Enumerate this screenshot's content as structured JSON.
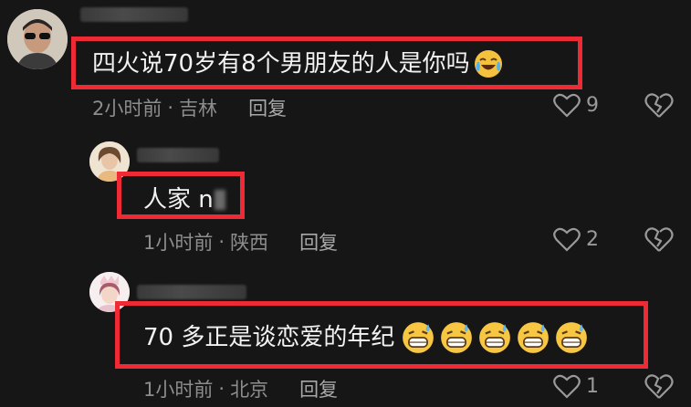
{
  "comments": [
    {
      "text": "四火说70岁有8个男朋友的人是你吗",
      "time": "2小时前",
      "location": "吉林",
      "reply_label": "回复",
      "likes": "9",
      "emoji": "crying-laughing-emoji"
    },
    {
      "text": "人家 n",
      "time": "1小时前",
      "location": "陕西",
      "reply_label": "回复",
      "likes": "2"
    },
    {
      "text": "70 多正是谈恋爱的年纪",
      "time": "1小时前",
      "location": "北京",
      "reply_label": "回复",
      "likes": "1",
      "emoji": "grinning-sweat-emoji",
      "emoji_count": 5
    }
  ],
  "meta_separator": "·",
  "colors": {
    "background": "#161616",
    "highlight": "#ee2a35",
    "meta": "#8d8d8d"
  }
}
